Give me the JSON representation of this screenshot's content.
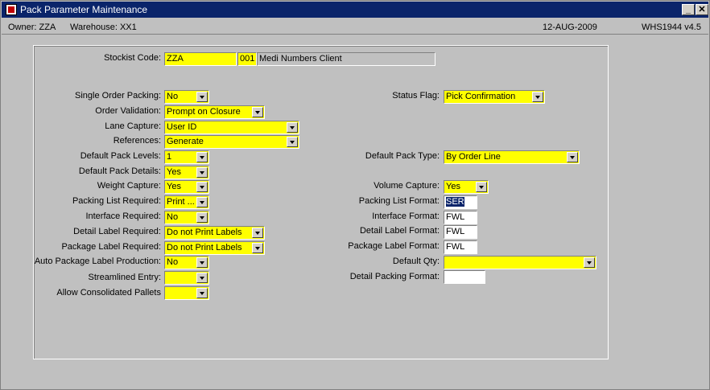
{
  "window": {
    "title": "Pack Parameter Maintenance"
  },
  "info": {
    "owner": "Owner:  ZZA",
    "warehouse": "Warehouse:  XX1",
    "date": "12-AUG-2009",
    "version": "WHS1944  v4.5"
  },
  "stockist": {
    "label": "Stockist Code:",
    "code": "ZZA",
    "num": "001",
    "name": "Medi Numbers Client"
  },
  "left_fields": [
    {
      "label": "Single Order Packing:",
      "value": "No"
    },
    {
      "label": "Order Validation:",
      "value": "Prompt on Closure"
    },
    {
      "label": "Lane Capture:",
      "value": "User ID"
    },
    {
      "label": "References:",
      "value": "Generate"
    },
    {
      "label": "Default Pack Levels:",
      "value": "1"
    },
    {
      "label": "Default Pack Details:",
      "value": "Yes"
    },
    {
      "label": "Weight Capture:",
      "value": "Yes"
    },
    {
      "label": "Packing List Required:",
      "value": "Print ..."
    },
    {
      "label": "Interface Required:",
      "value": "No"
    },
    {
      "label": "Detail Label Required:",
      "value": "Do not Print Labels"
    },
    {
      "label": "Package Label Required:",
      "value": "Do not Print Labels"
    },
    {
      "label": "Auto Package Label Production:",
      "value": "No"
    },
    {
      "label": "Streamlined Entry:",
      "value": ""
    },
    {
      "label": "Allow Consolidated Pallets",
      "value": ""
    }
  ],
  "right_fields": [
    {
      "label": "Status Flag:",
      "value": "Pick Confirmation"
    },
    {
      "label": "Default Pack Type:",
      "value": "By Order Line"
    },
    {
      "label": "Volume Capture:",
      "value": "Yes"
    },
    {
      "label": "Packing List Format:",
      "value": "SER"
    },
    {
      "label": "Interface Format:",
      "value": "FWL"
    },
    {
      "label": "Detail Label Format:",
      "value": "FWL"
    },
    {
      "label": "Package Label Format:",
      "value": "FWL"
    },
    {
      "label": "Default Qty:",
      "value": ""
    },
    {
      "label": "Detail Packing Format:",
      "value": ""
    }
  ]
}
